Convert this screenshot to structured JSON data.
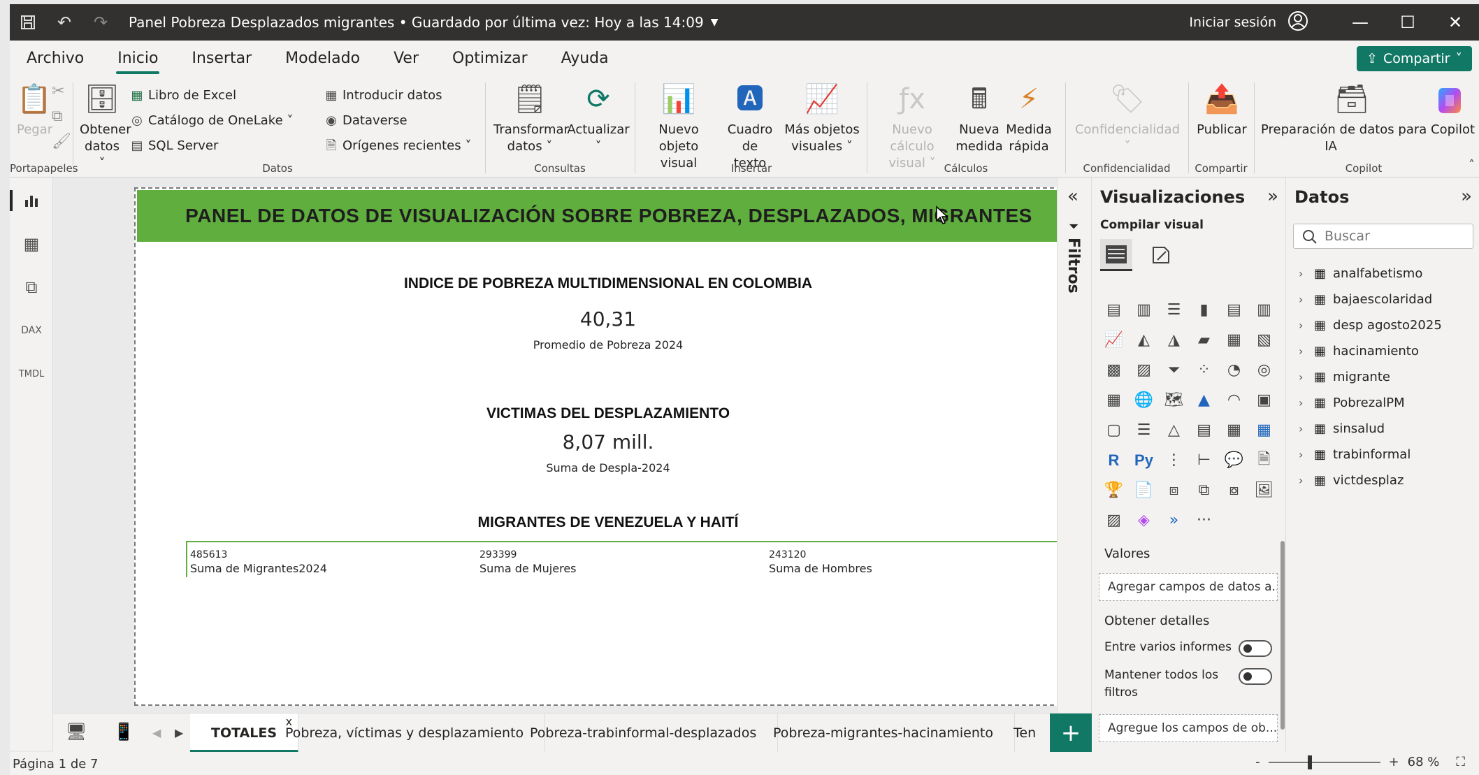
{
  "titlebar": {
    "title": "Panel Pobreza Desplazados migrantes • Guardado por última vez: Hoy a las 14:09",
    "signin": "Iniciar sesión"
  },
  "ribbon": {
    "tabs": [
      "Archivo",
      "Inicio",
      "Insertar",
      "Modelado",
      "Ver",
      "Optimizar",
      "Ayuda"
    ],
    "share": "Compartir",
    "groups": {
      "portapapeles": "Portapapeles",
      "datos": "Datos",
      "consultas": "Consultas",
      "insertar": "Insertar",
      "calculos": "Cálculos",
      "confidencialidad": "Confidencialidad",
      "compartir": "Compartir",
      "copilot": "Copilot"
    },
    "buttons": {
      "pegar": "Pegar",
      "obtener_datos_1": "Obtener",
      "obtener_datos_2": "datos ˅",
      "libro_excel": "Libro de Excel",
      "catalogo_onelake": "Catálogo de OneLake ˅",
      "sql_server": "SQL Server",
      "introducir_datos": "Introducir datos",
      "dataverse": "Dataverse",
      "origenes_recientes": "Orígenes recientes ˅",
      "transformar_1": "Transformar",
      "transformar_2": "datos ˅",
      "actualizar_1": "Actualizar",
      "actualizar_2": "˅",
      "nuevo_visual_1": "Nuevo objeto",
      "nuevo_visual_2": "visual",
      "cuadro_texto_1": "Cuadro de",
      "cuadro_texto_2": "texto",
      "mas_visuales_1": "Más objetos",
      "mas_visuales_2": "visuales ˅",
      "nuevo_calculo_1": "Nuevo cálculo",
      "nuevo_calculo_2": "visual ˅",
      "nueva_medida_1": "Nueva",
      "nueva_medida_2": "medida",
      "medida_rapida_1": "Medida",
      "medida_rapida_2": "rápida",
      "confidencialidad_1": "Confidencialidad",
      "confidencialidad_2": "˅",
      "publicar": "Publicar",
      "copilot_1": "Preparación de datos para Copilot",
      "copilot_2": "IA"
    }
  },
  "report": {
    "banner": "PANEL DE DATOS DE VISUALIZACIÓN SOBRE POBREZA, DESPLAZADOS, MIGRANTES",
    "ipm_title": "INDICE DE POBREZA MULTIDIMENSIONAL EN COLOMBIA",
    "ipm_value": "40,31",
    "ipm_label": "Promedio de Pobreza 2024",
    "desp_title": "VICTIMAS DEL DESPLAZAMIENTO",
    "desp_value": "8,07 mill.",
    "desp_label": "Suma de Despla-2024",
    "migr_title": "MIGRANTES DE VENEZUELA Y HAITÍ",
    "migr_cards": [
      {
        "value": "485613",
        "label": "Suma de Migrantes2024"
      },
      {
        "value": "293399",
        "label": "Suma de Mujeres"
      },
      {
        "value": "243120",
        "label": "Suma de Hombres"
      }
    ]
  },
  "pages": {
    "tabs": [
      "TOTALES",
      "Pobreza, víctimas y desplazamiento",
      "Pobreza-trabinformal-desplazados",
      "Pobreza-migrantes-hacinamiento",
      "Ten"
    ],
    "close": "x",
    "add": "+"
  },
  "status": {
    "page": "Página 1 de 7",
    "zoom_minus": "-",
    "zoom_plus": "+",
    "zoom": "68 %"
  },
  "filters": {
    "label": "Filtros"
  },
  "visualizations": {
    "title": "Visualizaciones",
    "build": "Compilar visual",
    "values": "Valores",
    "values_well": "Agregar campos de datos a...",
    "drill": "Obtener detalles",
    "cross_report": "Entre varios informes",
    "keep_filters": "Mantener todos los filtros",
    "drill_well": "Agregue los campos de ob...",
    "more": "···",
    "r_label": "R",
    "py_label": "Py"
  },
  "data_pane": {
    "title": "Datos",
    "search_placeholder": "Buscar",
    "tables": [
      "analfabetismo",
      "bajaescolaridad",
      "desp agosto2025",
      "hacinamiento",
      "migrante",
      "PobrezalPM",
      "sinsalud",
      "trabinformal",
      "victdesplaz"
    ]
  }
}
